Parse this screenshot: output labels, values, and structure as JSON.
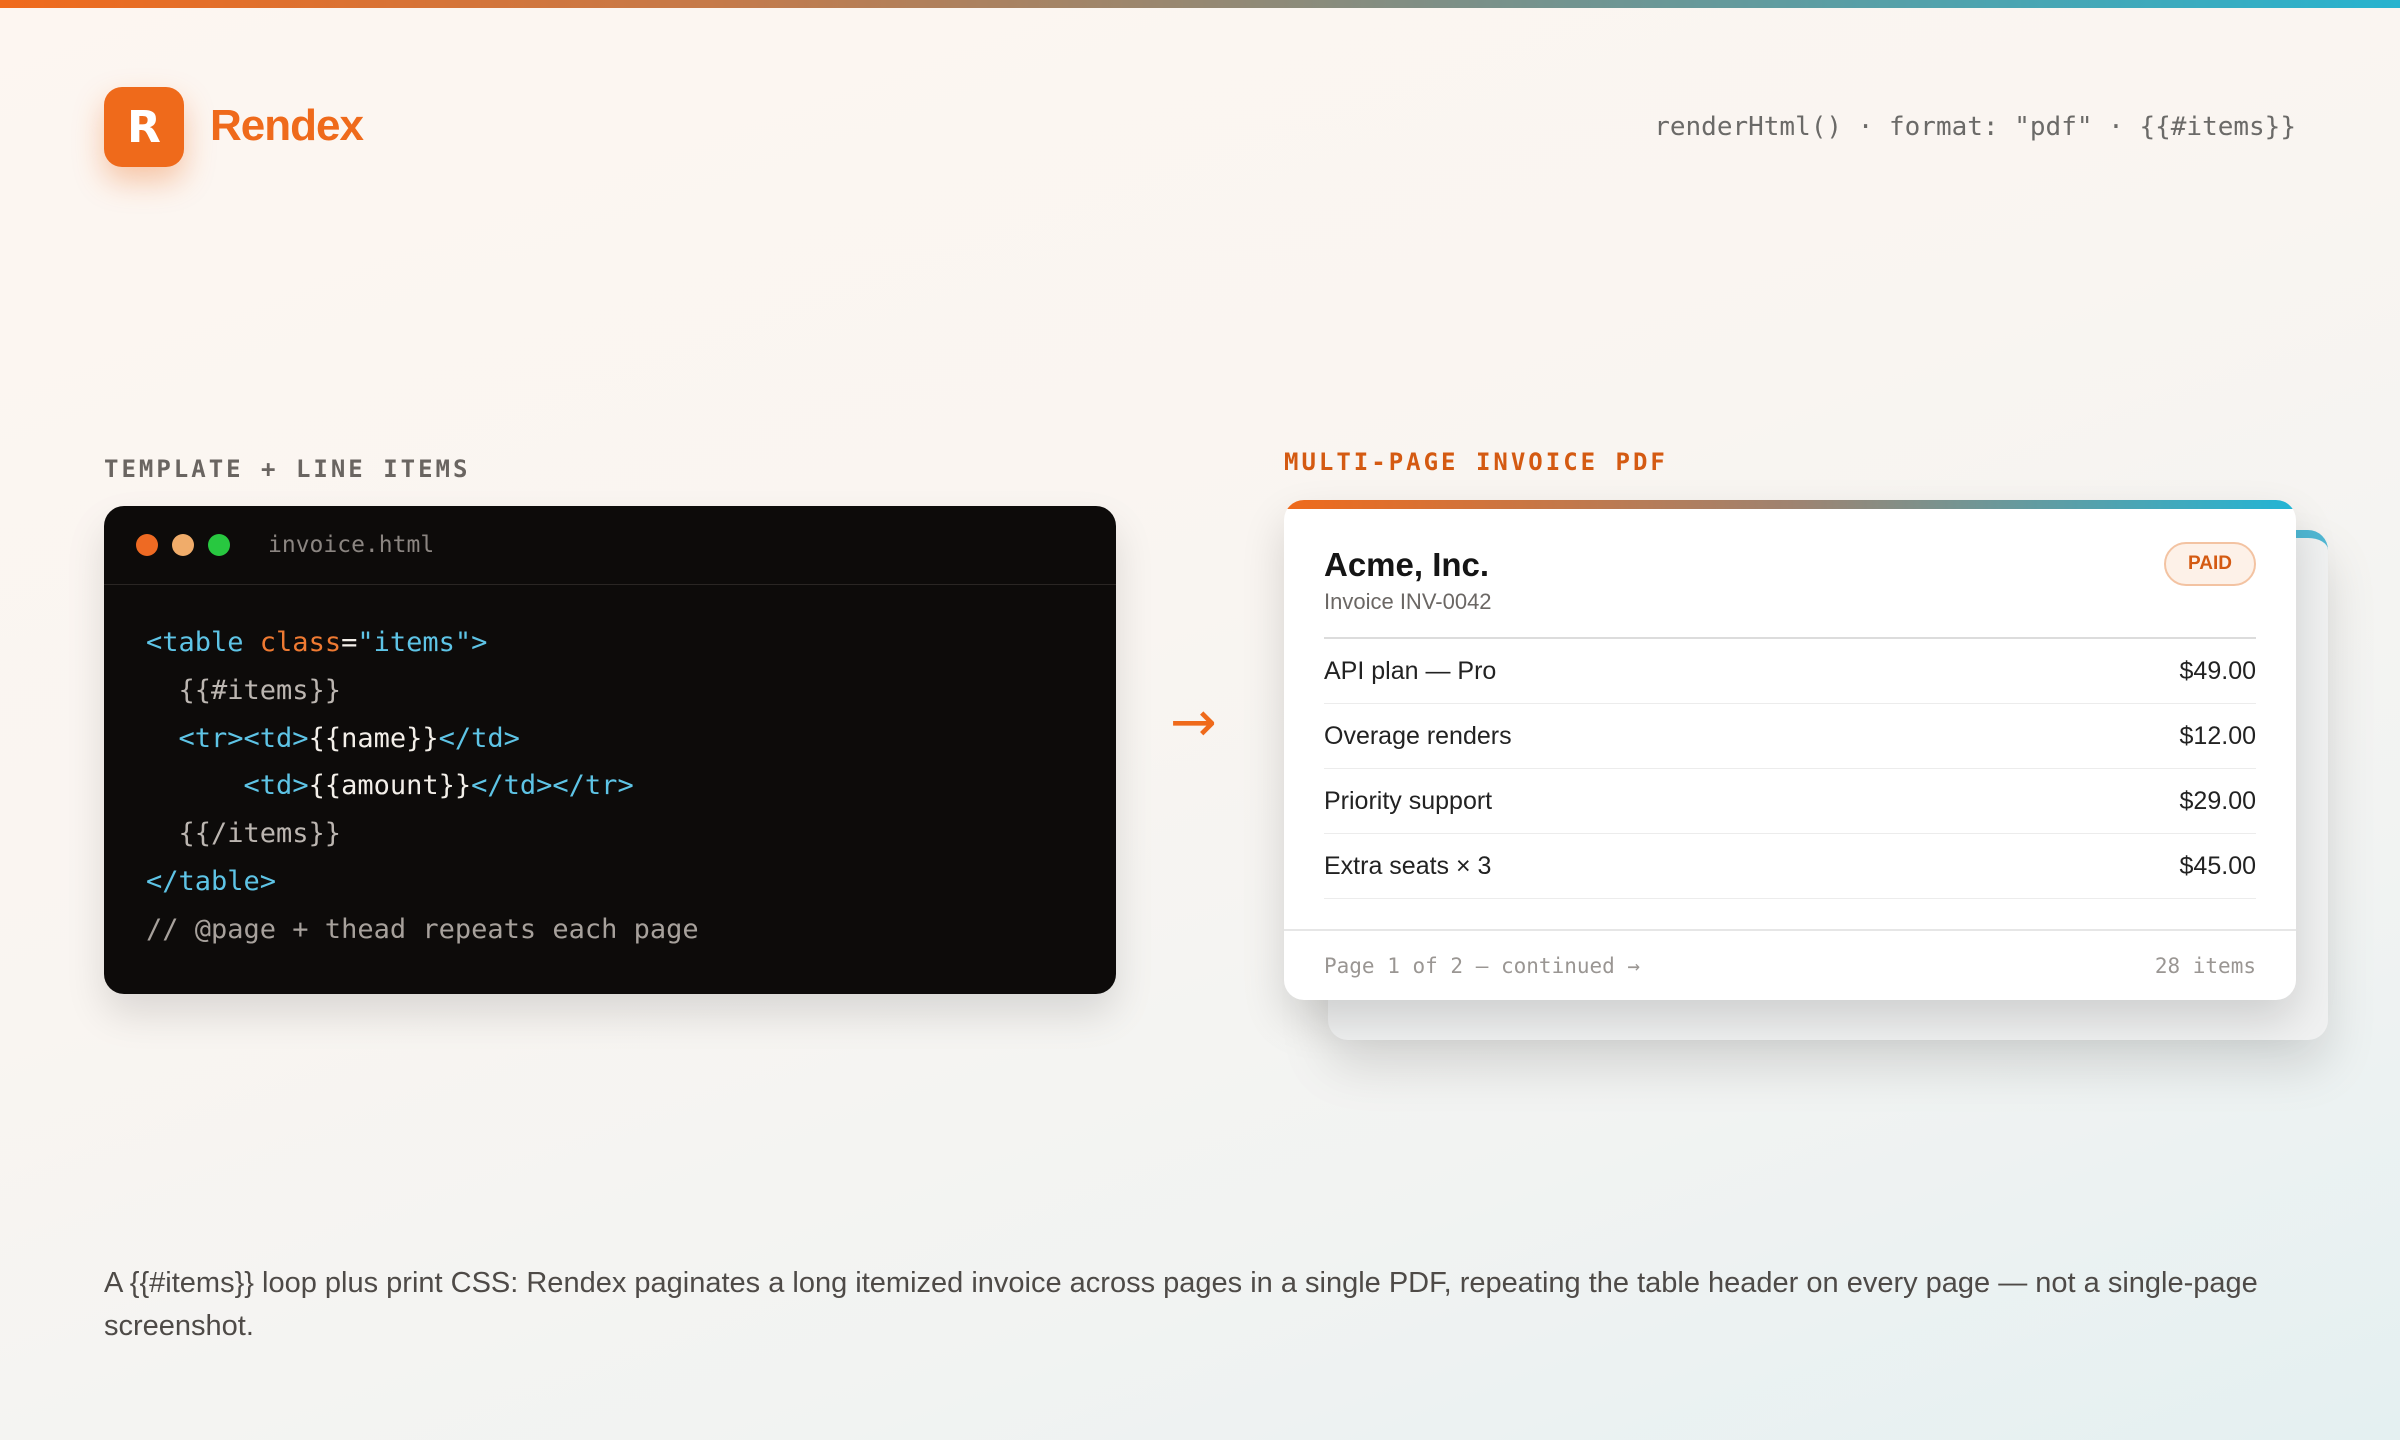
{
  "brand": {
    "logo_letter": "R",
    "name": "Rendex",
    "accent": "#ef6a1b"
  },
  "header": {
    "code_hint": "renderHtml() · format: \"pdf\" · {{#items}}"
  },
  "left": {
    "section_label": "TEMPLATE + LINE ITEMS",
    "editor": {
      "filename": "invoice.html",
      "lines": {
        "l1_open": "<table ",
        "l1_attr": "class",
        "l1_eq": "=",
        "l1_str": "\"items\"",
        "l1_close": ">",
        "l2": "  {{#items}}",
        "l3_tags": "  <tr><td>",
        "l3_expr": "{{name}}",
        "l3_end": "</td>",
        "l4_indent": "      ",
        "l4_tag": "<td>",
        "l4_expr": "{{amount}}",
        "l4_end": "</td></tr>",
        "l5": "  {{/items}}",
        "l6": "</table>",
        "l7": "// @page + thead repeats each page"
      }
    }
  },
  "arrow": "→",
  "right": {
    "section_label": "MULTI-PAGE INVOICE PDF",
    "invoice": {
      "company": "Acme, Inc.",
      "number": "Invoice INV-0042",
      "status": "PAID",
      "items": [
        {
          "name": "API plan — Pro",
          "amount": "$49.00"
        },
        {
          "name": "Overage renders",
          "amount": "$12.00"
        },
        {
          "name": "Priority support",
          "amount": "$29.00"
        },
        {
          "name": "Extra seats × 3",
          "amount": "$45.00"
        }
      ],
      "footer_page": "Page 1 of 2 — continued →",
      "footer_count": "28 items"
    }
  },
  "caption": "A {{#items}} loop plus print CSS: Rendex paginates a long itemized invoice across pages in a single PDF, repeating the table header on every page — not a single-page screenshot."
}
